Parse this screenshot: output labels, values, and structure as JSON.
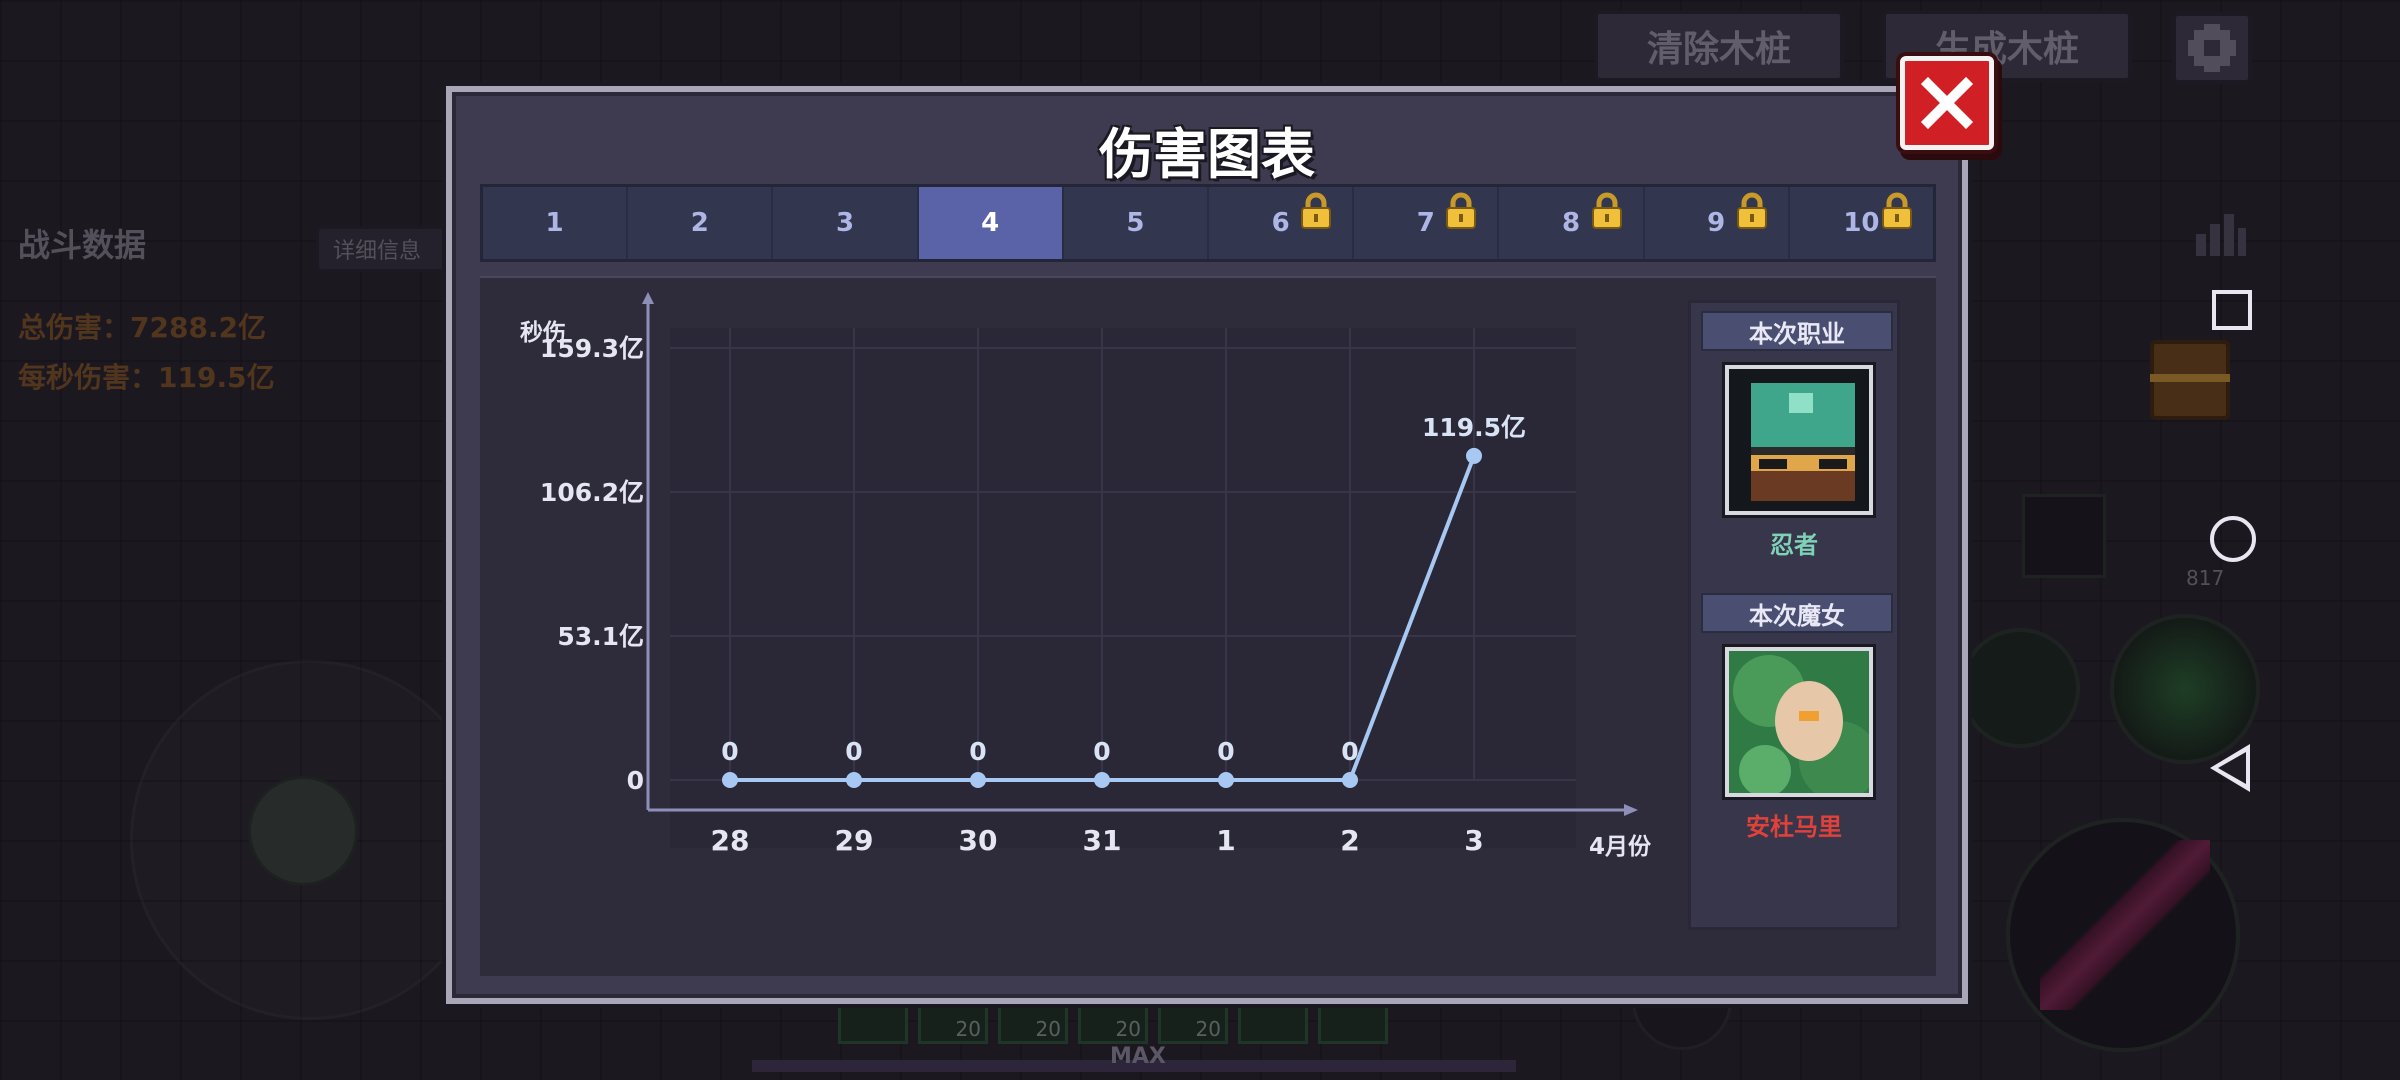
{
  "background": {
    "top_buttons": {
      "clear": "清除木桩",
      "generate": "生成木桩"
    },
    "stats": {
      "title": "战斗数据",
      "detail_button": "详细信息",
      "total_damage": "总伤害：7288.2亿",
      "dps": "每秒伤害：119.5亿"
    },
    "ammo": "817",
    "bottom_bar": {
      "slot_counts": [
        "",
        "20",
        "20",
        "20",
        "20",
        "",
        ""
      ],
      "level_label": "MAX"
    }
  },
  "modal": {
    "title": "伤害图表",
    "tabs": [
      {
        "label": "1",
        "locked": false,
        "active": false
      },
      {
        "label": "2",
        "locked": false,
        "active": false
      },
      {
        "label": "3",
        "locked": false,
        "active": false
      },
      {
        "label": "4",
        "locked": false,
        "active": true
      },
      {
        "label": "5",
        "locked": false,
        "active": false
      },
      {
        "label": "6",
        "locked": true,
        "active": false
      },
      {
        "label": "7",
        "locked": true,
        "active": false
      },
      {
        "label": "8",
        "locked": true,
        "active": false
      },
      {
        "label": "9",
        "locked": true,
        "active": false
      },
      {
        "label": "10",
        "locked": true,
        "active": false
      }
    ],
    "side": {
      "class_header": "本次职业",
      "class_name": "忍者",
      "witch_header": "本次魔女",
      "witch_name": "安杜马里"
    }
  },
  "colors": {
    "accent": "#5a62a8",
    "line": "#a7c8f2",
    "close": "#d11f26",
    "class_name": "#7fd1b8",
    "witch_name": "#e0413b"
  },
  "chart_data": {
    "type": "line",
    "ylabel": "秒伤",
    "xlabel": "4月份",
    "categories": [
      "28",
      "29",
      "30",
      "31",
      "1",
      "2",
      "3"
    ],
    "values": [
      0,
      0,
      0,
      0,
      0,
      0,
      119.5
    ],
    "data_labels": [
      "0",
      "0",
      "0",
      "0",
      "0",
      "0",
      "119.5亿"
    ],
    "y_ticks": [
      {
        "value": 0,
        "label": "0"
      },
      {
        "value": 53.1,
        "label": "53.1亿"
      },
      {
        "value": 106.2,
        "label": "106.2亿"
      },
      {
        "value": 159.3,
        "label": "159.3亿"
      }
    ],
    "ylim": [
      0,
      212.4
    ],
    "grid": true,
    "unit": "亿"
  }
}
